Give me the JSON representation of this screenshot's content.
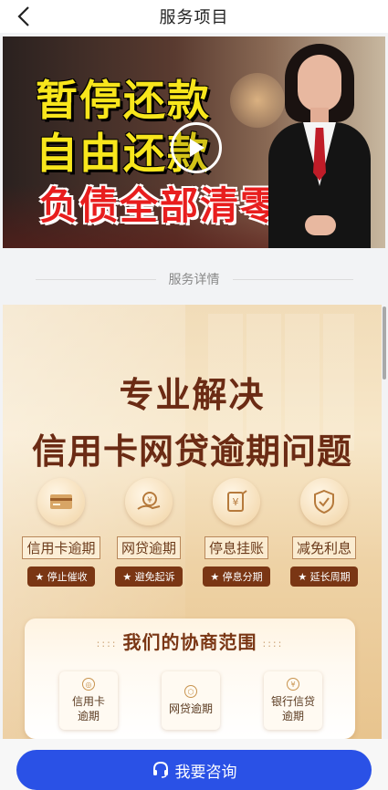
{
  "nav": {
    "title": "服务项目"
  },
  "video": {
    "line1": "暂停还款",
    "line2": "自由还款",
    "line3": "负债全部清零"
  },
  "section": {
    "label": "服务详情"
  },
  "poster": {
    "headline1": "专业解决",
    "headline2": "信用卡网贷逾期问题",
    "features": [
      {
        "icon": "card-icon",
        "title": "信用卡逾期",
        "tag": "★ 停止催收"
      },
      {
        "icon": "loan-hand-icon",
        "title": "网贷逾期",
        "tag": "★ 避免起诉"
      },
      {
        "icon": "yen-document-icon",
        "title": "停息挂账",
        "tag": "★ 停息分期"
      },
      {
        "icon": "shield-check-icon",
        "title": "减免利息",
        "tag": "★ 延长周期"
      }
    ],
    "scope": {
      "title": "我们的协商范围",
      "items": [
        {
          "icon": "coin-icon",
          "label": "信用卡\n逾期"
        },
        {
          "icon": "hexagon-icon",
          "label": "网贷逾期"
        },
        {
          "icon": "yen-icon",
          "label": "银行信贷\n逾期"
        }
      ]
    }
  },
  "bottom": {
    "button_label": "我要咨询",
    "button_color": "#2a51e6"
  }
}
